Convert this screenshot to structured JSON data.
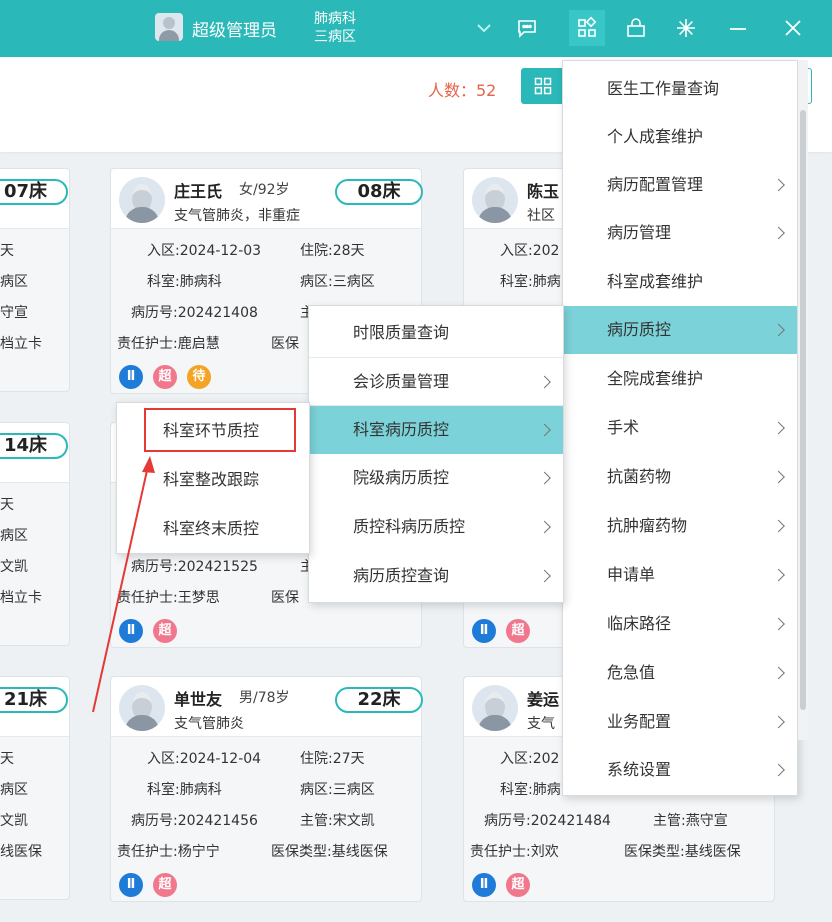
{
  "header": {
    "user_name": "超级管理员",
    "dept_line1": "肺病科",
    "dept_line2": "三病区",
    "icons": [
      "chevron-down-icon",
      "chat-icon",
      "apps-icon",
      "lock-icon",
      "snowflake-icon",
      "minimize-icon",
      "close-icon"
    ]
  },
  "subheader": {
    "count_text": "人数：52"
  },
  "left_cards": [
    {
      "bed": "07床",
      "f1": "天",
      "f2": "病区",
      "f3": "守宣",
      "f4": "档立卡"
    },
    {
      "bed": "14床",
      "f1": "天",
      "f2": "病区",
      "f3": "文凯",
      "f4": "档立卡"
    },
    {
      "bed": "21床",
      "f1": "天",
      "f2": "病区",
      "f3": "文凯",
      "f4": "线医保"
    }
  ],
  "cards": [
    {
      "name": "庄王氏",
      "gender_age": "女/92岁",
      "bed": "08床",
      "diagnosis": "支气管肺炎，非重症",
      "admit": "入区:2024-12-03",
      "days": "住院:28天",
      "dept": "科室:肺病科",
      "ward": "病区:三病区",
      "record": "病历号:202421408",
      "doctor": "主",
      "nurse": "责任护士:鹿启慧",
      "insurance": "医保",
      "badges": [
        "Ⅱ",
        "超",
        "待"
      ]
    },
    {
      "name": "",
      "gender_age": "",
      "bed": "",
      "diagnosis": "",
      "record": "病历号:202421525",
      "doctor": "主",
      "nurse": "责任护士:王梦思",
      "insurance": "医保",
      "badges": [
        "Ⅱ",
        "超"
      ]
    },
    {
      "name": "单世友",
      "gender_age": "男/78岁",
      "bed": "22床",
      "diagnosis": "支气管肺炎",
      "admit": "入区:2024-12-04",
      "days": "住院:27天",
      "dept": "科室:肺病科",
      "ward": "病区:三病区",
      "record": "病历号:202421456",
      "doctor": "主管:宋文凯",
      "nurse": "责任护士:杨宁宁",
      "insurance": "医保类型:基线医保",
      "badges": [
        "Ⅱ",
        "超"
      ]
    },
    {
      "name": "陈玉",
      "diagnosis": "社区",
      "admit": "入区:202",
      "dept": "科室:肺病"
    },
    {
      "badges": [
        "Ⅱ",
        "超"
      ]
    },
    {
      "name": "姜运",
      "diagnosis": "支气",
      "admit": "入区:202",
      "dept": "科室:肺病",
      "record": "病历号:202421484",
      "doctor": "主管:燕守宣",
      "nurse": "责任护士:刘欢",
      "insurance": "医保类型:基线医保",
      "badges": [
        "Ⅱ",
        "超"
      ]
    }
  ],
  "main_menu": [
    {
      "label": "医生工作量查询",
      "submenu": false
    },
    {
      "label": "个人成套维护",
      "submenu": false
    },
    {
      "label": "病历配置管理",
      "submenu": true
    },
    {
      "label": "病历管理",
      "submenu": true
    },
    {
      "label": "科室成套维护",
      "submenu": false
    },
    {
      "label": "病历质控",
      "submenu": true,
      "active": true
    },
    {
      "label": "全院成套维护",
      "submenu": false
    },
    {
      "label": "手术",
      "submenu": true
    },
    {
      "label": "抗菌药物",
      "submenu": true
    },
    {
      "label": "抗肿瘤药物",
      "submenu": true
    },
    {
      "label": "申请单",
      "submenu": true
    },
    {
      "label": "临床路径",
      "submenu": true
    },
    {
      "label": "危急值",
      "submenu": true
    },
    {
      "label": "业务配置",
      "submenu": true
    },
    {
      "label": "系统设置",
      "submenu": true
    }
  ],
  "qc_menu": [
    {
      "label": "时限质量查询",
      "submenu": false
    },
    {
      "label": "会诊质量管理",
      "submenu": true
    },
    {
      "label": "科室病历质控",
      "submenu": true,
      "active": true
    },
    {
      "label": "院级病历质控",
      "submenu": true
    },
    {
      "label": "质控科病历质控",
      "submenu": true
    },
    {
      "label": "病历质控查询",
      "submenu": true
    }
  ],
  "dept_qc_menu": [
    {
      "label": "科室环节质控"
    },
    {
      "label": "科室整改跟踪"
    },
    {
      "label": "科室终末质控"
    }
  ],
  "colors": {
    "brand": "#2ab8b8",
    "menu_active": "#7bd3d9",
    "count": "#e8624a",
    "highlight": "#e53935"
  }
}
